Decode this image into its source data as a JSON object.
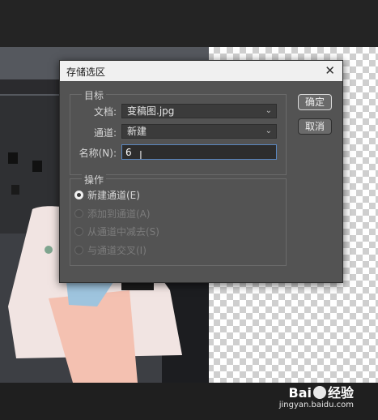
{
  "dialog": {
    "title": "存储选区",
    "close_glyph": "✕",
    "target_legend": "目标",
    "document_label": "文档:",
    "document_value": "变稿图.jpg",
    "channel_label": "通道:",
    "channel_value": "新建",
    "name_label": "名称(N):",
    "name_value": "6",
    "operation_legend": "操作",
    "operations": [
      {
        "label": "新建通道(E)",
        "selected": true,
        "enabled": true
      },
      {
        "label": "添加到通道(A)",
        "selected": false,
        "enabled": false
      },
      {
        "label": "从通道中减去(S)",
        "selected": false,
        "enabled": false
      },
      {
        "label": "与通道交叉(I)",
        "selected": false,
        "enabled": false
      }
    ],
    "ok_label": "确定",
    "cancel_label": "取消"
  },
  "watermark": {
    "brand_a": "Bai",
    "brand_b": "经验",
    "url": "jingyan.baidu.com"
  },
  "icons": {
    "close": "close-icon",
    "dropdown": "chevron-down-icon",
    "cursor": "text-cursor-icon"
  },
  "colors": {
    "dialog_bg": "#535353",
    "titlebar_bg": "#f0f0f0",
    "input_focus": "#5a86bf"
  }
}
